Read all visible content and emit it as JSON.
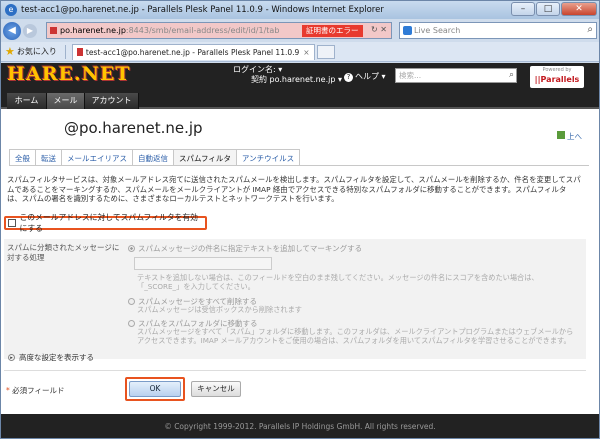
{
  "window": {
    "title": "test-acc1@po.harenet.ne.jp - Parallels Plesk Panel 11.0.9 - Windows Internet Explorer"
  },
  "address": {
    "url_host": "po.harenet.ne.jp",
    "url_rest": ":8443/smb/email-address/edit/id/1/tab",
    "cert_error": "証明書のエラー",
    "search_placeholder": "Live Search"
  },
  "favbar": {
    "favorites": "お気に入り",
    "tab_title": "test-acc1@po.harenet.ne.jp - Parallels Plesk Panel 11.0.9"
  },
  "header": {
    "logo": "HARE.NET",
    "login_label": "ログイン名:",
    "login_value": "",
    "contract_label": "契約",
    "contract_value": "po.harenet.ne.jp",
    "help": "ヘルプ",
    "search_placeholder": "検索...",
    "powered_by": "Powered by",
    "parallels": "||Parallels"
  },
  "nav": {
    "home": "ホーム",
    "mail": "メール",
    "account": "アカウント"
  },
  "main": {
    "address_title": "@po.harenet.ne.jp",
    "up_link": "上へ"
  },
  "tabs": [
    "全般",
    "転送",
    "メールエイリアス",
    "自動返信",
    "スパムフィルタ",
    "アンチウイルス"
  ],
  "spam": {
    "description": "スパムフィルタサービスは、対象メールアドレス宛てに送信されたスパムメールを検出します。スパムフィルタを設定して、スパムメールを削除するか、件名を変更してスパムであることをマーキングするか、スパムメールをメールクライアントが IMAP 経由でアクセスできる特別なスパムフォルダに移動することができます。スパムフィルタは、スパムの署名を識別するために、さまざまなローカルテストとネットワークテストを行います。",
    "enable_label": "このメールアドレスに対してスパムフィルタを有効にする",
    "section_label": "スパムに分類されたメッセージに対する処理",
    "opt_mark": "スパムメッセージの件名に指定テキストを追加してマーキングする",
    "opt_mark_note": "テキストを追加しない場合は、このフィールドを空白のまま残してください。メッセージの件名にスコアを含めたい場合は、「_SCORE_」を入力してください。",
    "opt_delete": "スパムメッセージをすべて削除する",
    "opt_delete_note": "スパムメッセージは受信ボックスから削除されます",
    "opt_move": "スパムをスパムフォルダに移動する",
    "opt_move_note": "スパムメッセージをすべて「スパム」フォルダに移動します。このフォルダは、メールクライアントプログラムまたはウェブメールからアクセスできます。IMAP メールアカウントをご使用の場合は、スパムフォルダを用いてスパムフィルタを学習させることができます。",
    "advanced": "高度な設定を表示する"
  },
  "form": {
    "required": "必須フィールド",
    "ok": "OK",
    "cancel": "キャンセル"
  },
  "footer": {
    "copyright": "© Copyright 1999-2012. Parallels IP Holdings GmbH. All rights reserved."
  }
}
